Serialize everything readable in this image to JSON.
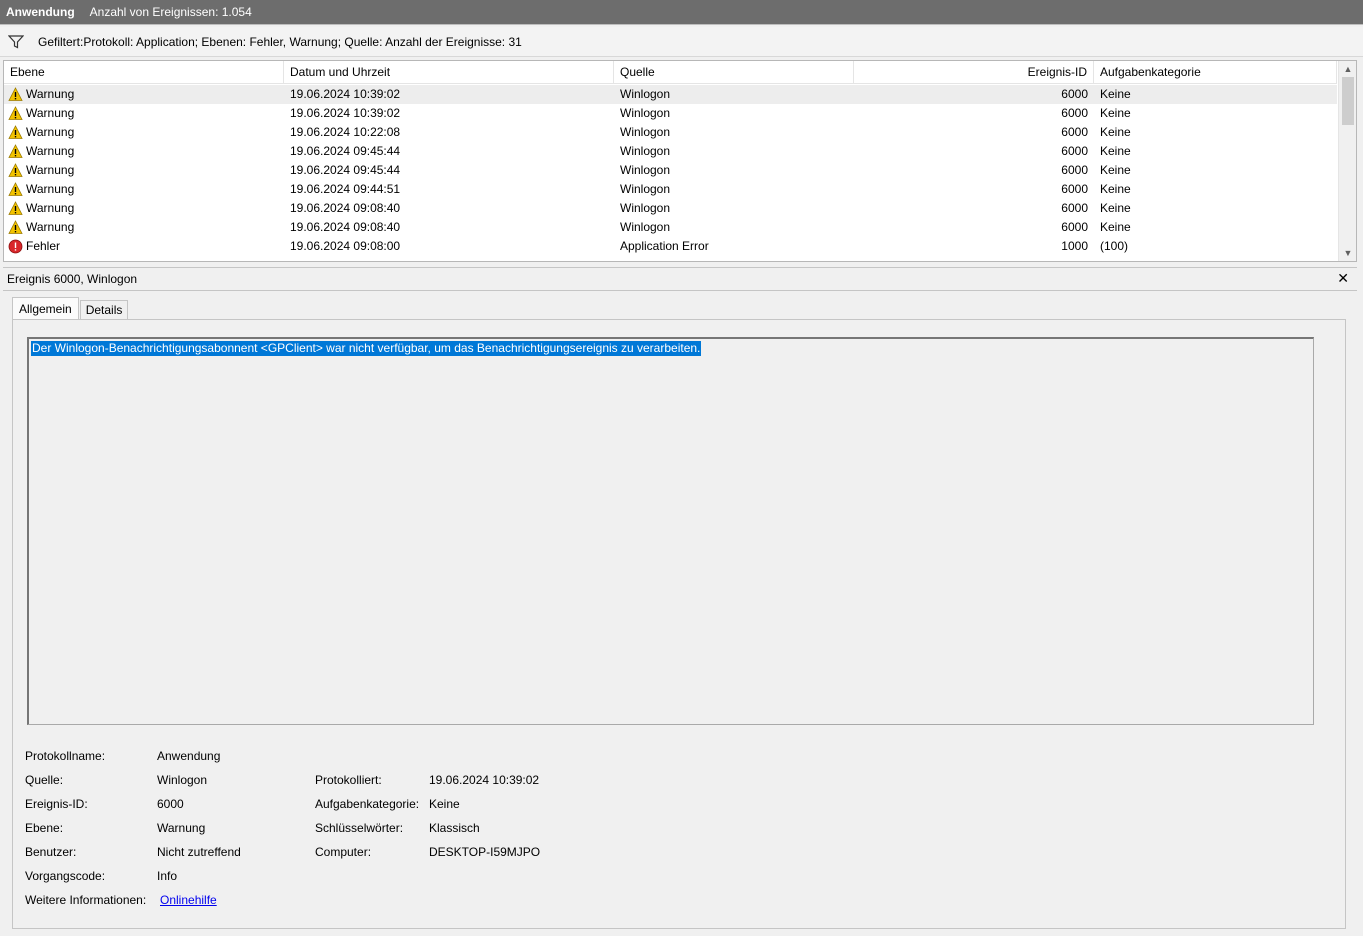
{
  "titlebar": {
    "log_name": "Anwendung",
    "event_count": "Anzahl von Ereignissen: 1.054"
  },
  "filter": {
    "text": "Gefiltert:Protokoll: Application; Ebenen: Fehler, Warnung; Quelle:  Anzahl der Ereignisse: 31",
    "icon": "funnel-icon"
  },
  "columns": [
    "Ebene",
    "Datum und Uhrzeit",
    "Quelle",
    "Ereignis-ID",
    "Aufgabenkategorie"
  ],
  "rows": [
    {
      "level": "Warnung",
      "icon": "warning-icon",
      "date": "19.06.2024 10:39:02",
      "source": "Winlogon",
      "id": "6000",
      "category": "Keine"
    },
    {
      "level": "Warnung",
      "icon": "warning-icon",
      "date": "19.06.2024 10:39:02",
      "source": "Winlogon",
      "id": "6000",
      "category": "Keine"
    },
    {
      "level": "Warnung",
      "icon": "warning-icon",
      "date": "19.06.2024 10:22:08",
      "source": "Winlogon",
      "id": "6000",
      "category": "Keine"
    },
    {
      "level": "Warnung",
      "icon": "warning-icon",
      "date": "19.06.2024 09:45:44",
      "source": "Winlogon",
      "id": "6000",
      "category": "Keine"
    },
    {
      "level": "Warnung",
      "icon": "warning-icon",
      "date": "19.06.2024 09:45:44",
      "source": "Winlogon",
      "id": "6000",
      "category": "Keine"
    },
    {
      "level": "Warnung",
      "icon": "warning-icon",
      "date": "19.06.2024 09:44:51",
      "source": "Winlogon",
      "id": "6000",
      "category": "Keine"
    },
    {
      "level": "Warnung",
      "icon": "warning-icon",
      "date": "19.06.2024 09:08:40",
      "source": "Winlogon",
      "id": "6000",
      "category": "Keine"
    },
    {
      "level": "Warnung",
      "icon": "warning-icon",
      "date": "19.06.2024 09:08:40",
      "source": "Winlogon",
      "id": "6000",
      "category": "Keine"
    },
    {
      "level": "Fehler",
      "icon": "error-icon",
      "date": "19.06.2024 09:08:00",
      "source": "Application Error",
      "id": "1000",
      "category": "(100)"
    }
  ],
  "detail": {
    "title": "Ereignis 6000, Winlogon",
    "close": "✕",
    "tabs": [
      "Allgemein",
      "Details"
    ],
    "message": "Der Winlogon-Benachrichtigungsabonnent <GPClient> war nicht verfügbar, um das Benachrichtigungsereignis zu verarbeiten.",
    "props": {
      "protokollname_label": "Protokollname:",
      "protokollname": "Anwendung",
      "quelle_label": "Quelle:",
      "quelle": "Winlogon",
      "protokolliert_label": "Protokolliert:",
      "protokolliert": "19.06.2024 10:39:02",
      "id_label": "Ereignis-ID:",
      "id": "6000",
      "aufgabe_label": "Aufgabenkategorie:",
      "aufgabe": "Keine",
      "ebene_label": "Ebene:",
      "ebene": "Warnung",
      "schluessel_label": "Schlüsselwörter:",
      "schluessel": "Klassisch",
      "benutzer_label": "Benutzer:",
      "benutzer": "Nicht zutreffend",
      "computer_label": "Computer:",
      "computer": "DESKTOP-I59MJPO",
      "vorgang_label": "Vorgangscode:",
      "vorgang": "Info",
      "weitere_label": "Weitere Informationen:",
      "weitere": "Onlinehilfe"
    }
  },
  "colors": {
    "selection": "#0078d7",
    "titlebar": "#6d6d6d",
    "warning": "#f2c200",
    "error": "#d9262a"
  }
}
